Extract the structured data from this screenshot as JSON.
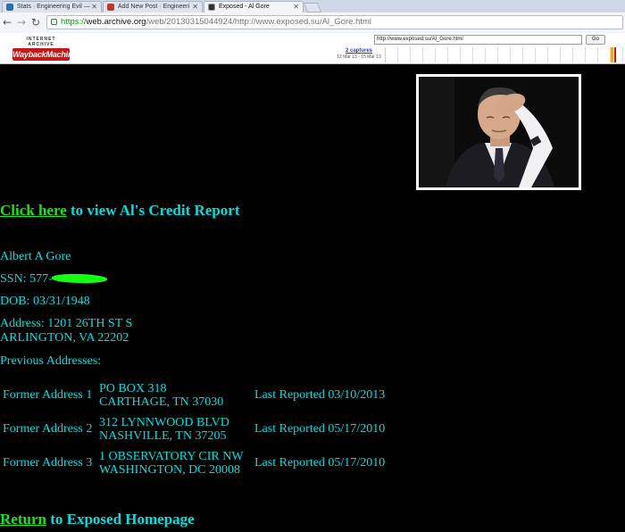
{
  "browser": {
    "tabs": [
      {
        "title": "Stats · Engineering Evil —",
        "active": false
      },
      {
        "title": "Add New Post · Engineeri",
        "active": false
      },
      {
        "title": "Exposed - Al Gore",
        "active": true
      }
    ],
    "url_scheme": "https://",
    "url_host": "web.archive.org",
    "url_rest": "/web/20130315044924/http://www.exposed.su/Al_Gore.html",
    "back_icon": "arrow-left-icon",
    "forward_icon": "arrow-right-icon",
    "reload_icon": "reload-icon"
  },
  "wayback": {
    "brand_small": "INTERNET ARCHIVE",
    "brand_logo": "WaybackMachine",
    "lookup_url": "http://www.exposed.su/Al_Gore.html",
    "go_label": "Go",
    "captures_label": "2 captures",
    "captures_range": "12 Mar 13 - 15 Mar 13"
  },
  "page": {
    "credit_link": "Click here",
    "credit_text": " to view Al's Credit Report",
    "name": "Albert A Gore",
    "ssn_prefix": "SSN: 577-",
    "dob": "DOB: 03/31/1948",
    "address_line1": "Address: 1201 26TH ST S",
    "address_line2": "ARLINGTON,  VA  22202",
    "previous_heading": "Previous Addresses:",
    "previous_addresses": [
      {
        "label": "Former Address 1",
        "line1": "PO BOX 318",
        "line2": "CARTHAGE,  TN  37030",
        "reported": "Last Reported 03/10/2013"
      },
      {
        "label": "Former Address 2",
        "line1": "312 LYNNWOOD BLVD",
        "line2": "NASHVILLE,  TN  37205",
        "reported": "Last Reported 05/17/2010"
      },
      {
        "label": "Former Address 3",
        "line1": "1 OBSERVATORY CIR NW",
        "line2": "WASHINGTON,  DC  20008",
        "reported": "Last Reported 05/17/2010"
      }
    ],
    "return_link": "Return",
    "return_text": " to Exposed Homepage"
  },
  "colors": {
    "page_bg": "#000000",
    "text": "#00e0e0",
    "link": "#19e619",
    "redaction": "#14ff14"
  }
}
